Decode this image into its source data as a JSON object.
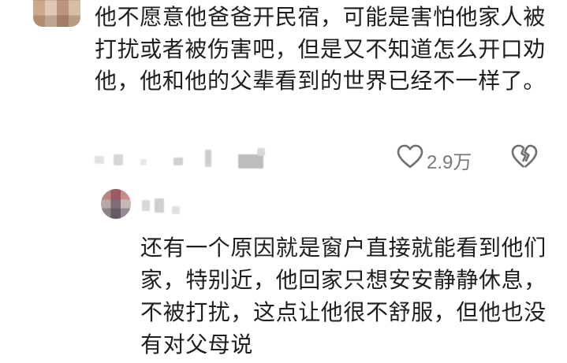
{
  "comment": {
    "text": "他不愿意他爸爸开民宿，可能是害怕他家人被打扰或者被伤害吧，但是又不知道怎么开口劝他，他和他的父辈看到的世界已经不一样了。",
    "like_count": "2.9万"
  },
  "reply": {
    "text": "还有一个原因就是窗户直接就能看到他们家，特别近，他回家只想安安静静休息，不被打扰，这点让他很不舒服，但他也没有对父母说"
  },
  "icons": {
    "like": "heart-outline-icon",
    "dislike": "broken-heart-icon"
  }
}
